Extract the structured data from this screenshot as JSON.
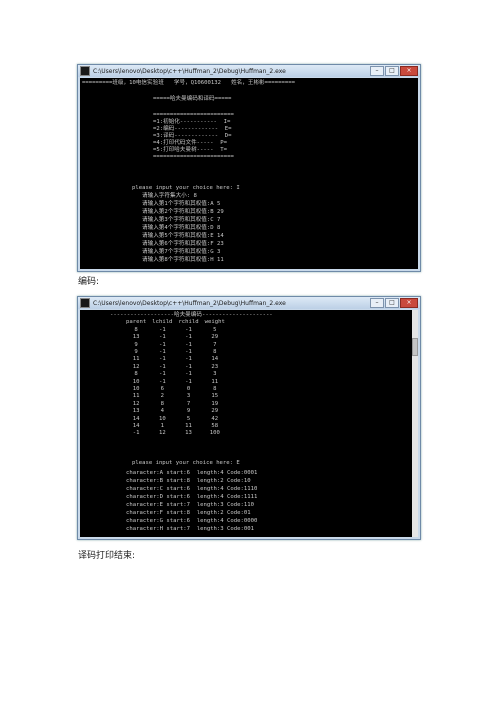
{
  "window1": {
    "title": "C:\\Users\\lenovo\\Desktop\\c++\\Huffman_2\\Debug\\Huffman_2.exe",
    "lines": [
      "=========班级，10电信实验班   学号，Q10600132   姓名，王彬彬=========",
      "=====哈夫曼编码和译码=====",
      "========================",
      "=1:初始化-----------  I=",
      "=2:编码-------------  E=",
      "=3:译码-------------  D=",
      "=4:打印代码文件-----  P=",
      "=5:打印哈夫曼树-----  T=",
      "========================",
      "please input your choice here: I",
      "请输入字符集大小: 8",
      "请输入第1个字符和其权值:A 5",
      "请输入第2个字符和其权值:B 29",
      "请输入第3个字符和其权值:C 7",
      "请输入第4个字符和其权值:D 8",
      "请输入第5个字符和其权值:E 14",
      "请输入第6个字符和其权值:F 23",
      "请输入第7个字符和其权值:G 3",
      "请输入第8个字符和其权值:H 11"
    ]
  },
  "caption1": "编码:",
  "window2": {
    "title": "C:\\Users\\lenovo\\Desktop\\c++\\Huffman_2\\Debug\\Huffman_2.exe",
    "header_line": "-------------------哈夫曼编码---------------------",
    "table_headers": [
      "parent",
      "lchild",
      "rchild",
      "weight"
    ],
    "rows": [
      [
        "8",
        "-1",
        "-1",
        "5"
      ],
      [
        "13",
        "-1",
        "-1",
        "29"
      ],
      [
        "9",
        "-1",
        "-1",
        "7"
      ],
      [
        "9",
        "-1",
        "-1",
        "8"
      ],
      [
        "11",
        "-1",
        "-1",
        "14"
      ],
      [
        "12",
        "-1",
        "-1",
        "23"
      ],
      [
        "8",
        "-1",
        "-1",
        "3"
      ],
      [
        "10",
        "-1",
        "-1",
        "11"
      ],
      [
        "10",
        "6",
        "0",
        "8"
      ],
      [
        "11",
        "2",
        "3",
        "15"
      ],
      [
        "12",
        "8",
        "7",
        "19"
      ],
      [
        "13",
        "4",
        "9",
        "29"
      ],
      [
        "14",
        "10",
        "5",
        "42"
      ],
      [
        "14",
        "1",
        "11",
        "58"
      ],
      [
        "-1",
        "12",
        "13",
        "100"
      ]
    ],
    "prompt": "please input your choice here: E",
    "codes": [
      "character:A start:6  length:4 Code:0001",
      "character:B start:8  length:2 Code:10",
      "character:C start:6  length:4 Code:1110",
      "character:D start:6  length:4 Code:1111",
      "character:E start:7  length:3 Code:110",
      "character:F start:8  length:2 Code:01",
      "character:G start:6  length:4 Code:0000",
      "character:H start:7  length:3 Code:001"
    ]
  },
  "caption2": "译码打印结束:",
  "window_controls": {
    "minimize": "–",
    "maximize": "□",
    "close": "×"
  }
}
